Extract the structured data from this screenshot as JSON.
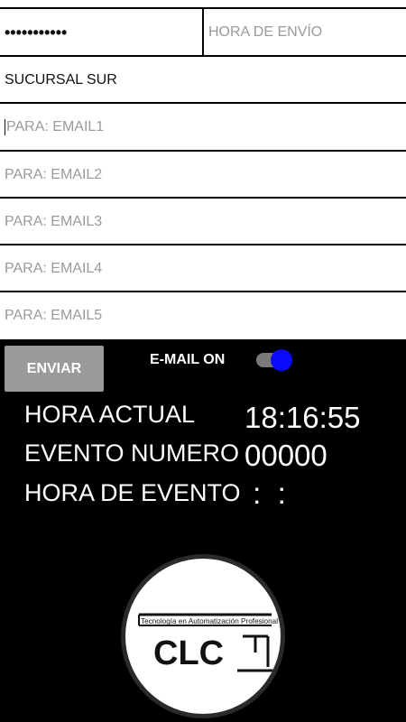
{
  "form": {
    "password_value": "•••••••••••",
    "send_time_placeholder": "HORA DE ENVÍO",
    "branch_value": "SUCURSAL SUR",
    "email_placeholders": [
      "PARA: EMAIL1",
      "PARA: EMAIL2",
      "PARA: EMAIL3",
      "PARA: EMAIL4",
      "PARA: EMAIL5"
    ]
  },
  "controls": {
    "send_label": "ENVIAR",
    "email_toggle_label": "E-MAIL ON",
    "email_toggle_on": true
  },
  "status": {
    "current_time_label": "HORA ACTUAL",
    "current_time_value": "18:16:55",
    "event_number_label": "EVENTO NUMERO",
    "event_number_value": "00000",
    "event_time_label": "HORA DE EVENTO",
    "event_time_value": " :  :"
  },
  "logo": {
    "tagline": "Tecnología en Automatización Profesional",
    "brand": "CLC"
  },
  "colors": {
    "toggle_thumb": "#0a0aff",
    "button_bg": "#9a9a9a"
  }
}
